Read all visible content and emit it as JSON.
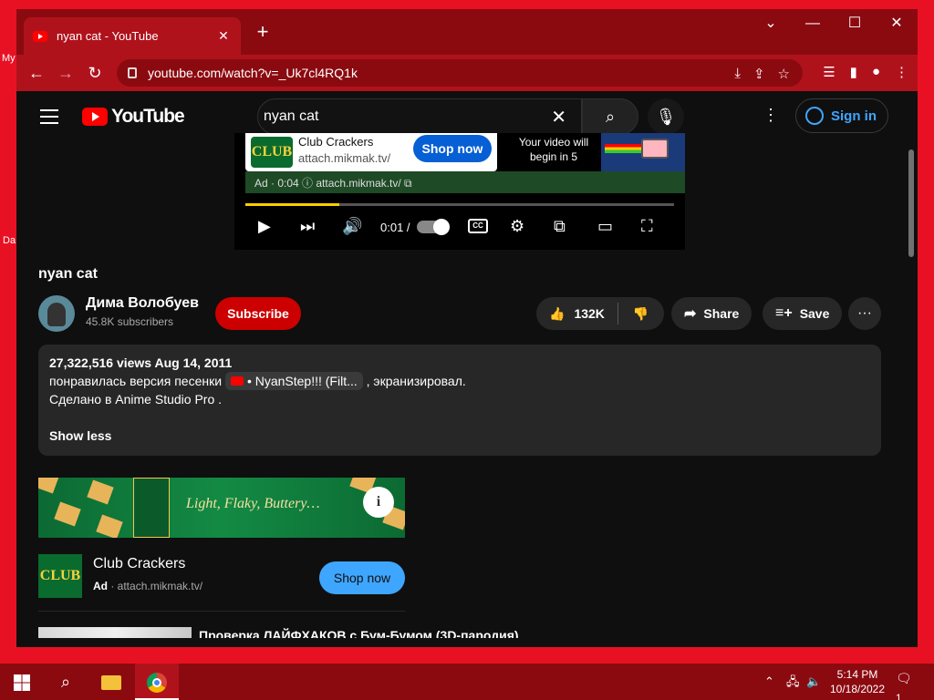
{
  "desktop": {
    "label_top": "My",
    "label_bottom": "Da"
  },
  "browser": {
    "tab_title": "nyan cat - YouTube",
    "tab_close": "✕",
    "new_tab": "+",
    "window_controls": {
      "dropdown": "⌄",
      "minimize": "—",
      "maximize": "☐",
      "close": "✕"
    },
    "back": "←",
    "forward": "→",
    "reload": "↻",
    "url": "youtube.com/watch?v=_Uk7cl4RQ1k"
  },
  "youtube": {
    "logo_text": "YouTube",
    "search_value": "nyan cat",
    "search_placeholder": "Search",
    "clear": "✕",
    "signin": "Sign in",
    "more": "⋮"
  },
  "player": {
    "ad_brand": "Club Crackers",
    "ad_url": "attach.mikmak.tv/",
    "shop_now": "Shop now",
    "ad_meta": "Ad · 0:04  ⓘ  attach.mikmak.tv/ ⧉",
    "skip_text": "Your video will begin in 5",
    "time": "0:01 /",
    "progress_fraction": 0.22,
    "logo_text": "CLUB"
  },
  "video": {
    "title": "nyan cat",
    "channel": "Дима Волобуев",
    "subscribers": "45.8K subscribers",
    "subscribe": "Subscribe",
    "likes": "132K",
    "share": "Share",
    "save": "Save",
    "more": "···"
  },
  "description": {
    "meta": "27,322,516 views  Aug 14, 2011",
    "line1_prefix": "понравилась версия песенки",
    "chip": "• NyanStep!!! (Filt...",
    "line1_suffix": ", экранизировал.",
    "line2": "Сделано в Anime Studio Pro .",
    "show_less": "Show less"
  },
  "sidebar_ad": {
    "tagline": "Light, Flaky, Buttery…",
    "info": "i",
    "logo_text": "CLUB",
    "title": "Club Crackers",
    "ad_label": "Ad",
    "url": "· attach.mikmak.tv/",
    "shop_now": "Shop now"
  },
  "recommended": [
    {
      "title": "Проверка ЛАЙФХАКОВ с Бум-Бумом (3D-пародия)"
    }
  ],
  "taskbar": {
    "time": "5:14 PM",
    "date": "10/18/2022",
    "notifications": "1"
  }
}
